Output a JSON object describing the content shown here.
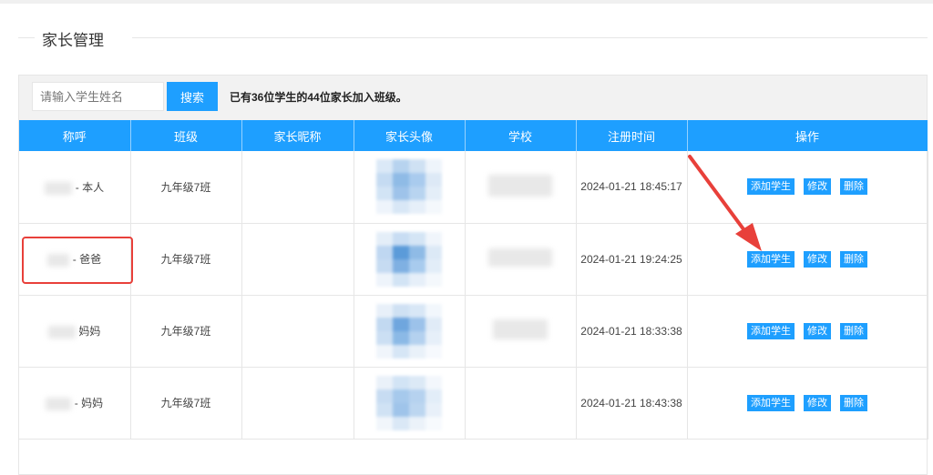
{
  "page": {
    "title": "家长管理"
  },
  "toolbar": {
    "search_placeholder": "请输入学生姓名",
    "search_label": "搜索",
    "summary": "已有36位学生的44位家长加入班级。"
  },
  "table": {
    "headers": [
      "称呼",
      "班级",
      "家长昵称",
      "家长头像",
      "学校",
      "注册时间",
      "操作"
    ],
    "actions": {
      "add": "添加学生",
      "edit": "修改",
      "delete": "删除"
    },
    "rows": [
      {
        "name": "- 本人",
        "class": "九年级7班",
        "time": "2024-01-21 18:45:17"
      },
      {
        "name": "- 爸爸",
        "class": "九年级7班",
        "time": "2024-01-21 19:24:25"
      },
      {
        "name": "妈妈",
        "class": "九年级7班",
        "time": "2024-01-21 18:33:38"
      },
      {
        "name": "- 妈妈",
        "class": "九年级7班",
        "time": "2024-01-21 18:43:38"
      }
    ]
  },
  "colors": {
    "accent": "#1e9fff",
    "highlight": "#e8403a"
  }
}
